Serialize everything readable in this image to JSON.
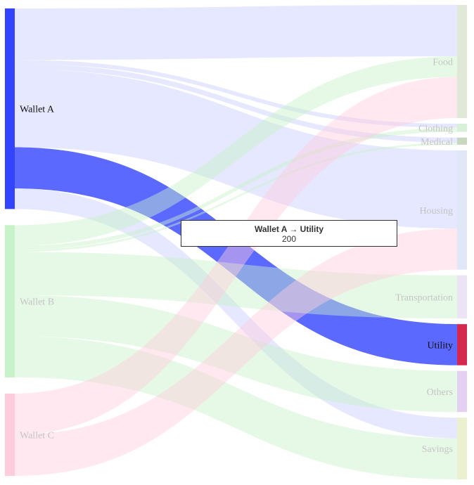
{
  "chart_data": {
    "type": "sankey",
    "nodes": [
      {
        "id": "wa",
        "name": "Wallet A",
        "side": "source",
        "color": "#3344ff",
        "highlight": true
      },
      {
        "id": "wb",
        "name": "Wallet B",
        "side": "source",
        "color": "#c8f2c8"
      },
      {
        "id": "wc",
        "name": "Wallet C",
        "side": "source",
        "color": "#ffccdd"
      },
      {
        "id": "food",
        "name": "Food",
        "side": "target",
        "color": "#e0e8d8"
      },
      {
        "id": "clothing",
        "name": "Clothing",
        "side": "target",
        "color": "#d8f0d8"
      },
      {
        "id": "medical",
        "name": "Medical",
        "side": "target",
        "color": "#c8d8c0"
      },
      {
        "id": "housing",
        "name": "Housing",
        "side": "target",
        "color": "#e0e8f8"
      },
      {
        "id": "transport",
        "name": "Transportation",
        "side": "target",
        "color": "#ece4f4"
      },
      {
        "id": "utility",
        "name": "Utility",
        "side": "target",
        "color": "#d4284e",
        "highlight": true
      },
      {
        "id": "others",
        "name": "Others",
        "side": "target",
        "color": "#e4d0f0"
      },
      {
        "id": "savings",
        "name": "Savings",
        "side": "target",
        "color": "#eaf0d0"
      }
    ],
    "links": [
      {
        "source": "wa",
        "target": "food",
        "value": 250
      },
      {
        "source": "wa",
        "target": "clothing",
        "value": 20
      },
      {
        "source": "wa",
        "target": "medical",
        "value": 25
      },
      {
        "source": "wa",
        "target": "housing",
        "value": 380
      },
      {
        "source": "wa",
        "target": "utility",
        "value": 200,
        "highlight": true
      },
      {
        "source": "wa",
        "target": "savings",
        "value": 100
      },
      {
        "source": "wb",
        "target": "food",
        "value": 100
      },
      {
        "source": "wb",
        "target": "clothing",
        "value": 20
      },
      {
        "source": "wb",
        "target": "medical",
        "value": 10
      },
      {
        "source": "wb",
        "target": "transport",
        "value": 210
      },
      {
        "source": "wb",
        "target": "others",
        "value": 200
      },
      {
        "source": "wb",
        "target": "savings",
        "value": 200
      },
      {
        "source": "wc",
        "target": "food",
        "value": 200
      },
      {
        "source": "wc",
        "target": "housing",
        "value": 200
      }
    ]
  },
  "tooltip": {
    "title": "Wallet A → Utility",
    "value": "200"
  }
}
